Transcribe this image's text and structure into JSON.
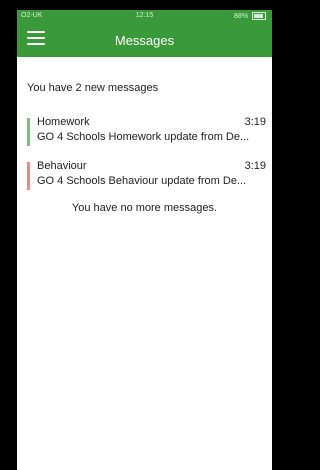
{
  "status": {
    "carrier": "O2-UK",
    "time": "12:15",
    "battery": "88%"
  },
  "header": {
    "title": "Messages"
  },
  "summary": "You have 2 new messages",
  "messages": [
    {
      "title": "Homework",
      "time": "3:19",
      "preview": "GO 4 Schools Homework update from De...",
      "color": "#7fbf7f"
    },
    {
      "title": "Behaviour",
      "time": "3:19",
      "preview": "GO 4 Schools Behaviour update from De...",
      "color": "#e68a8a"
    }
  ],
  "footer_text": "You have no more messages.",
  "theme": {
    "header_bg": "#3a9a3a"
  }
}
